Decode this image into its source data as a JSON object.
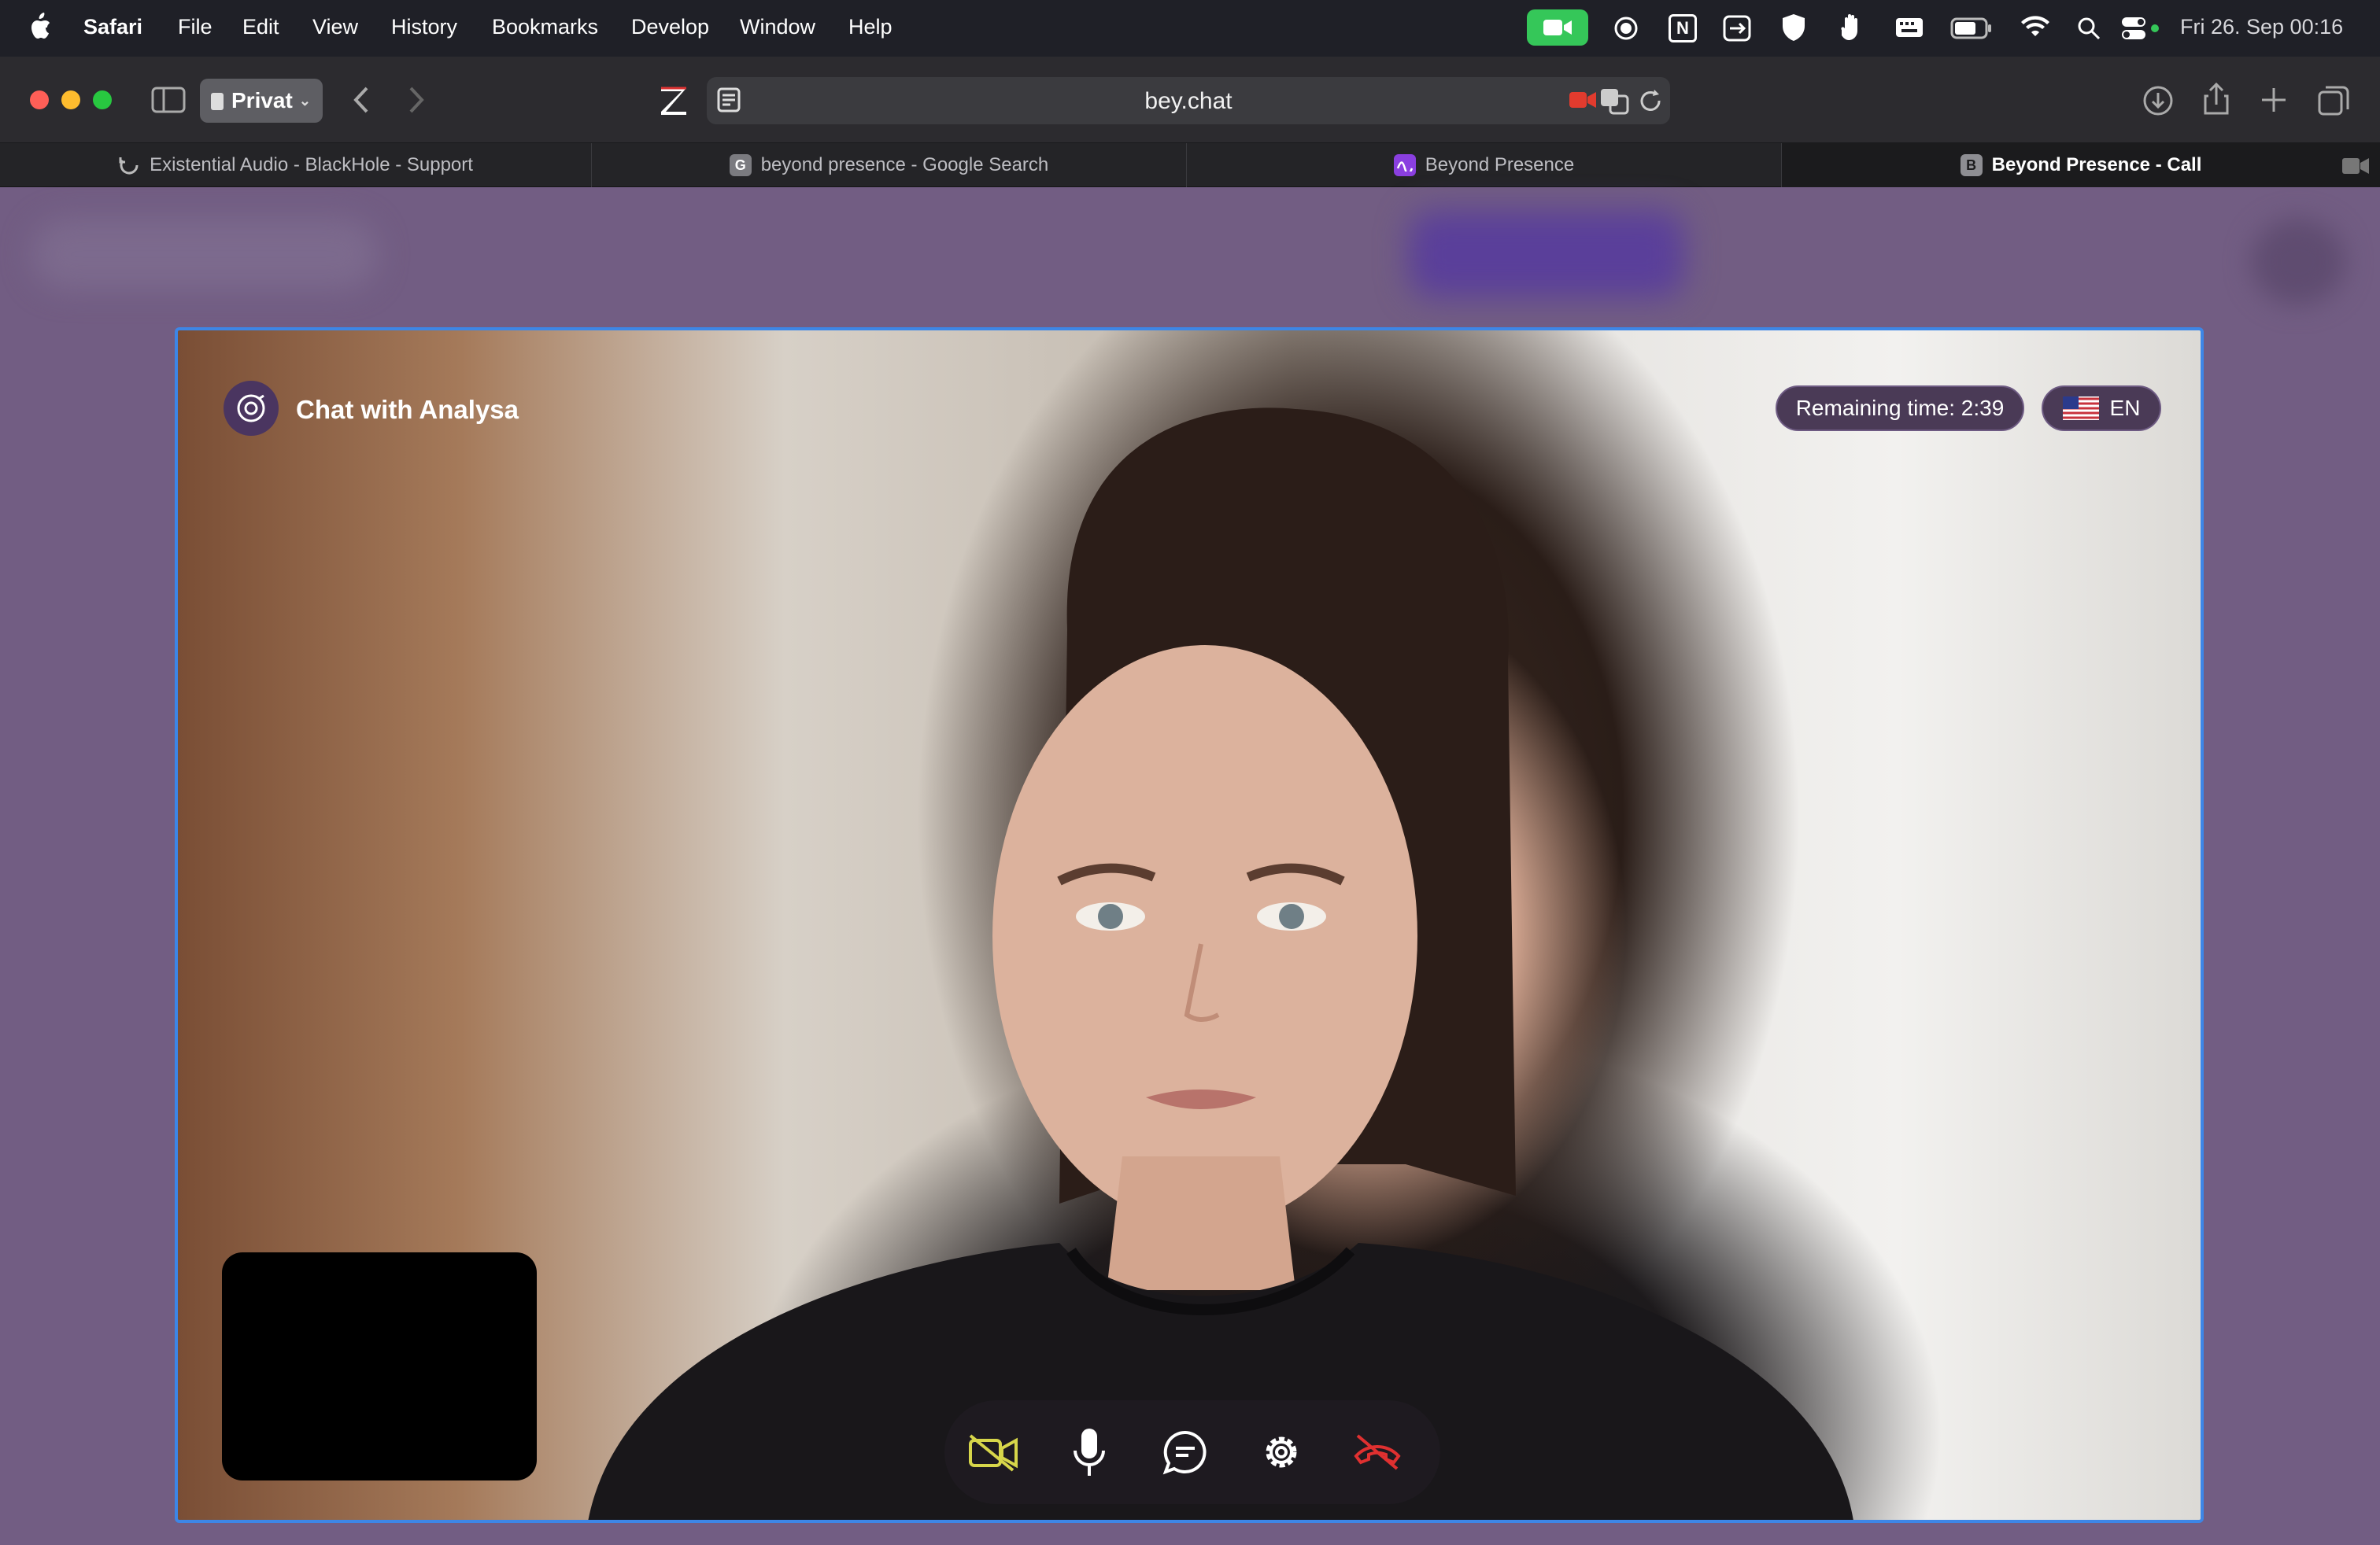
{
  "menubar": {
    "app": "Safari",
    "items": [
      "File",
      "Edit",
      "View",
      "History",
      "Bookmarks",
      "Develop",
      "Window",
      "Help"
    ],
    "datetime": "Fri 26. Sep 00:16"
  },
  "toolbar": {
    "profile": "Privat",
    "url": "bey.chat"
  },
  "tabs": [
    {
      "label": "Existential Audio - BlackHole - Support"
    },
    {
      "label": "beyond presence - Google Search",
      "favicon": "G"
    },
    {
      "label": "Beyond Presence"
    },
    {
      "label": "Beyond Presence - Call",
      "favicon": "B"
    }
  ],
  "call": {
    "title": "Chat with Analysa",
    "remaining": "Remaining time: 2:39",
    "language": "EN"
  },
  "colors": {
    "page_bg": "#725d83",
    "pill_bg": "#4a3a56",
    "accent_border": "#3d86e6",
    "cam_off": "#d7d64a",
    "end_call": "#e03030"
  }
}
